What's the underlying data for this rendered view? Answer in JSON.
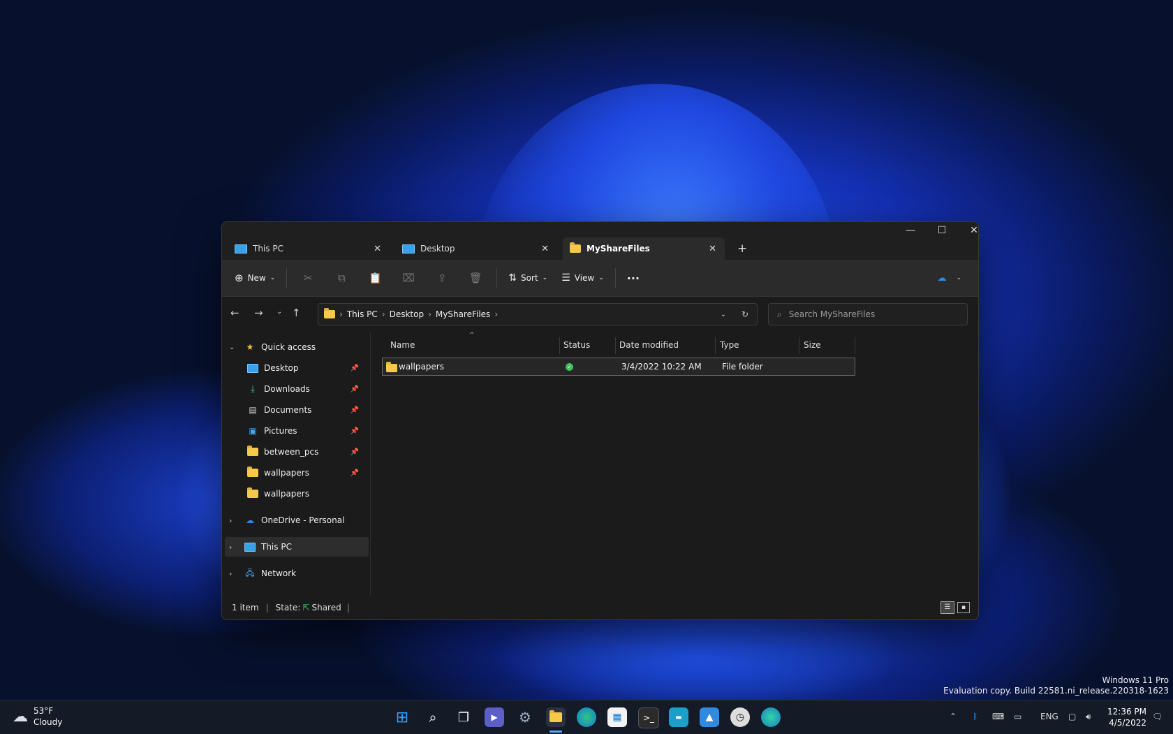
{
  "tabs": [
    {
      "label": "This PC",
      "icon": "monitor-icon"
    },
    {
      "label": "Desktop",
      "icon": "desktop-icon"
    },
    {
      "label": "MyShareFiles",
      "icon": "folder-icon"
    }
  ],
  "toolbar": {
    "new_label": "New",
    "sort_label": "Sort",
    "view_label": "View"
  },
  "breadcrumb": [
    "This PC",
    "Desktop",
    "MyShareFiles"
  ],
  "search": {
    "placeholder": "Search MyShareFiles"
  },
  "sidebar": {
    "quick_access": "Quick access",
    "items": [
      {
        "label": "Desktop",
        "icon": "desktop-icon",
        "pinned": true
      },
      {
        "label": "Downloads",
        "icon": "download-icon",
        "pinned": true
      },
      {
        "label": "Documents",
        "icon": "document-icon",
        "pinned": true
      },
      {
        "label": "Pictures",
        "icon": "pictures-icon",
        "pinned": true
      },
      {
        "label": "between_pcs",
        "icon": "folder-icon",
        "pinned": true
      },
      {
        "label": "wallpapers",
        "icon": "folder-icon",
        "pinned": true
      },
      {
        "label": "wallpapers",
        "icon": "shared-folder-icon",
        "pinned": false
      }
    ],
    "onedrive": "OneDrive - Personal",
    "this_pc": "This PC",
    "network": "Network"
  },
  "columns": {
    "name": "Name",
    "status": "Status",
    "date": "Date modified",
    "type": "Type",
    "size": "Size"
  },
  "files": [
    {
      "name": "wallpapers",
      "status": "synced",
      "date": "3/4/2022 10:22 AM",
      "type": "File folder",
      "size": ""
    }
  ],
  "statusbar": {
    "count": "1 item",
    "state_label": "State:",
    "state_value": "Shared"
  },
  "watermark": {
    "line1": "Windows 11 Pro",
    "line2": "Evaluation copy. Build 22581.ni_release.220318-1623"
  },
  "weather": {
    "temp": "53°F",
    "condition": "Cloudy"
  },
  "tray": {
    "lang": "ENG",
    "time": "12:36 PM",
    "date": "4/5/2022"
  },
  "colors": {
    "accent": "#2e8ae6",
    "folder": "#f7c948"
  }
}
